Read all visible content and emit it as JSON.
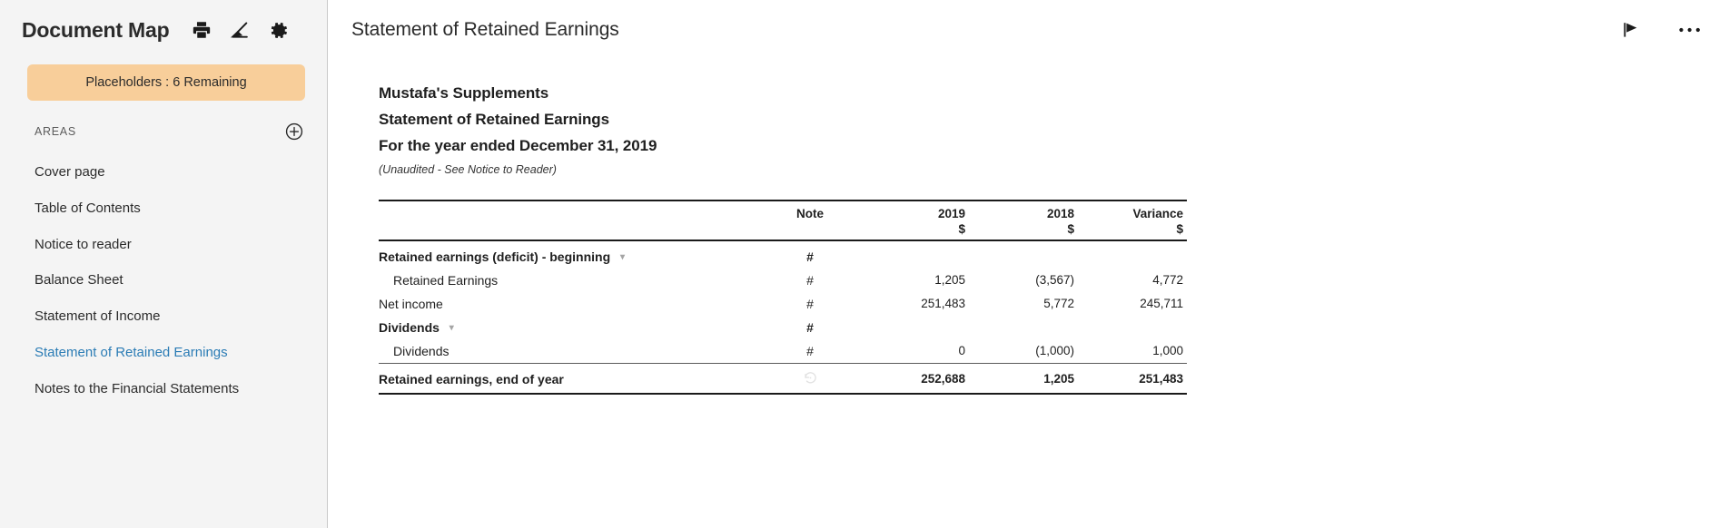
{
  "sidebar": {
    "title": "Document Map",
    "toolbar": [
      {
        "name": "print-icon",
        "label": "Print"
      },
      {
        "name": "edit-pen-icon",
        "label": "Edit"
      },
      {
        "name": "gear-icon",
        "label": "Settings"
      }
    ],
    "placeholder_badge": {
      "label": "Placeholders : 6 Remaining",
      "color": "#f8ce9a"
    },
    "areas_label": "AREAS",
    "add_area_label": "Add area",
    "items": [
      {
        "label": "Cover page",
        "active": false
      },
      {
        "label": "Table of Contents",
        "active": false
      },
      {
        "label": "Notice to reader",
        "active": false
      },
      {
        "label": "Balance Sheet",
        "active": false
      },
      {
        "label": "Statement of Income",
        "active": false
      },
      {
        "label": "Statement of Retained Earnings",
        "active": true
      },
      {
        "label": "Notes to the Financial Statements",
        "active": false
      }
    ],
    "active_color": "#2b7cb5"
  },
  "header": {
    "title": "Statement of Retained Earnings",
    "flag_icon_label": "Flag",
    "more_icon_label": "More options"
  },
  "document": {
    "company": "Mustafa's Supplements",
    "statement": "Statement of Retained Earnings",
    "period": "For the year ended December 31, 2019",
    "audit_note": "(Unaudited - See Notice to Reader)"
  },
  "table": {
    "columns": [
      "",
      "Note",
      "2019",
      "2018",
      "Variance"
    ],
    "currency_row": [
      "",
      "",
      "$",
      "$",
      "$"
    ],
    "rows": [
      {
        "label": "Retained earnings (deficit) - beginning",
        "note": "#",
        "y2019": "",
        "y2018": "",
        "variance": "",
        "bold": true,
        "indent": false,
        "chevron": true
      },
      {
        "label": "Retained Earnings",
        "note": "#",
        "y2019": "1,205",
        "y2018": "(3,567)",
        "variance": "4,772",
        "bold": false,
        "indent": true,
        "chevron": false
      },
      {
        "label": "Net income",
        "note": "#",
        "y2019": "251,483",
        "y2018": "5,772",
        "variance": "245,711",
        "bold": false,
        "indent": false,
        "chevron": false
      },
      {
        "label": "Dividends",
        "note": "#",
        "y2019": "",
        "y2018": "",
        "variance": "",
        "bold": true,
        "indent": false,
        "chevron": true
      },
      {
        "label": "Dividends",
        "note": "#",
        "y2019": "0",
        "y2018": "(1,000)",
        "variance": "1,000",
        "bold": false,
        "indent": true,
        "chevron": false
      }
    ],
    "total_row": {
      "label": "Retained earnings, end of year",
      "note": "",
      "y2019": "252,688",
      "y2018": "1,205",
      "variance": "251,483",
      "history_icon": "history-icon"
    }
  }
}
